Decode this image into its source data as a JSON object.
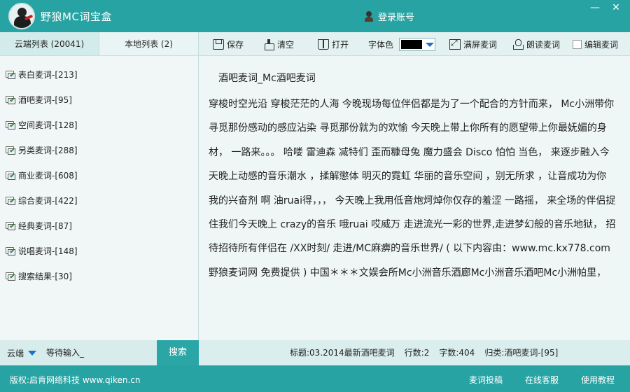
{
  "app": {
    "title": "野狼MC词宝盒",
    "login_label": "登录账号"
  },
  "window": {
    "minimize": "—",
    "close": "✕"
  },
  "left_tabs": {
    "cloud": "云端列表 (20041)",
    "local": "本地列表 (2)"
  },
  "categories": [
    {
      "label": "表白麦词-[213]"
    },
    {
      "label": "酒吧麦词-[95]"
    },
    {
      "label": "空间麦词-[128]"
    },
    {
      "label": "另类麦词-[288]"
    },
    {
      "label": "商业麦词-[608]"
    },
    {
      "label": "综合麦词-[422]"
    },
    {
      "label": "经典麦词-[87]"
    },
    {
      "label": "说唱麦词-[148]"
    },
    {
      "label": "搜索结果-[30]"
    }
  ],
  "toolbar": {
    "save": "保存",
    "clear": "清空",
    "open": "打开",
    "font_color_label": "字体色",
    "font_color": "#000000",
    "fullscreen": "满屏麦词",
    "read_aloud": "朗读麦词",
    "edit": "编辑麦词"
  },
  "content": {
    "title": "酒吧麦词_Mc酒吧麦词",
    "lyrics": "穿梭时空光沿 穿梭茫茫的人海  今晚现场每位伴侣都是为了一个配合的方针而来， Mc小洲带你  寻觅那份感动的感应沾染 寻觅那份就为的欢愉  今天晚上带上你所有的愿望带上你最妩媚的身材，  一路来。。。  哈喽 雷迪森 减特们 歪而糠母兔 魔力盛会 Disco 怕怕 当色，  来逐步融入今天晚上动感的音乐潮水 ，揉解懲体  明灭的霓虹 华丽的音乐空间 ，别无所求 ，让音成功为你我的兴奋剂 啊 油ruai得，，，  今天晚上我用低音炮炣焯你仅存的羞涩 一路摇，  来全场的伴侣捉住我们今天晚上 crazy的音乐 哦ruai 哎威万  走进流光一彩的世界,走进梦幻般的音乐地狱，  招待招待所有伴侣在 /XX时刻/ 走进/MC麻痹的音乐世界/  ( 以下内容由：www.mc.kx778.com 野狼麦词网 免费提供 )  中国＊＊＊文娱会所Mc小洲音乐酒廊Mc小洲音乐酒吧Mc小洲帕里，"
  },
  "search": {
    "scope": "云端",
    "placeholder": "等待输入_",
    "button": "搜索"
  },
  "status": {
    "title": "标题:03.2014最新酒吧麦词",
    "lines": "行数:2",
    "chars": "字数:404",
    "category": "归类:酒吧麦词-[95]"
  },
  "footer": {
    "copyright": "版权:启肯网络科技 www.qiken.cn",
    "submit": "麦词投稿",
    "support": "在线客服",
    "tutorial": "使用教程"
  }
}
